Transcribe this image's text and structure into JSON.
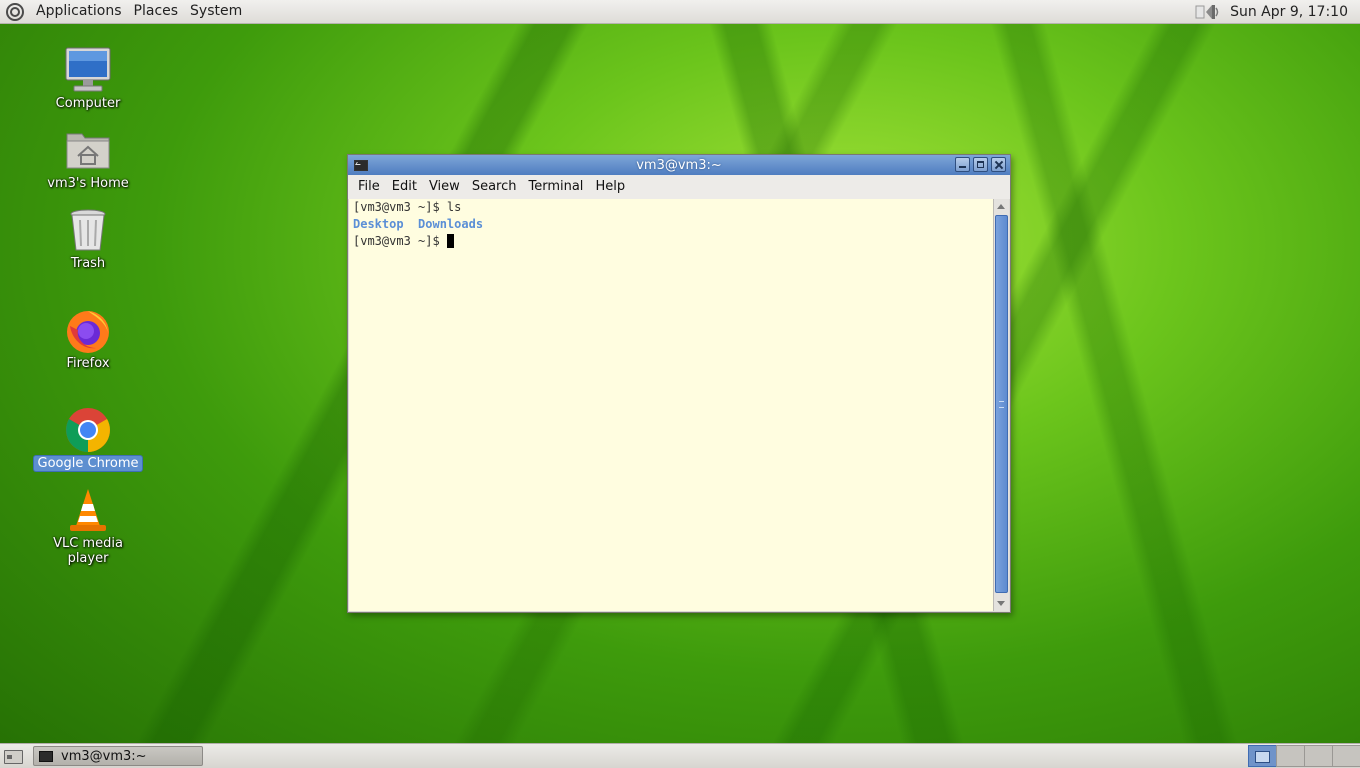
{
  "top_panel": {
    "menus": [
      "Applications",
      "Places",
      "System"
    ],
    "clock": "Sun Apr  9, 17:10"
  },
  "desktop_icons": [
    {
      "label": "Computer",
      "icon": "computer-icon"
    },
    {
      "label": "vm3's Home",
      "icon": "home-folder-icon"
    },
    {
      "label": "Trash",
      "icon": "trash-icon"
    },
    {
      "label": "Firefox",
      "icon": "firefox-icon"
    },
    {
      "label": "Google Chrome",
      "icon": "chrome-icon",
      "selected": true
    },
    {
      "label": "VLC media player",
      "icon": "vlc-icon"
    }
  ],
  "terminal": {
    "title": "vm3@vm3:~",
    "menus": [
      "File",
      "Edit",
      "View",
      "Search",
      "Terminal",
      "Help"
    ],
    "lines": {
      "line1": "[vm3@vm3 ~]$ ls",
      "dir1": "Desktop",
      "dir2": "Downloads",
      "prompt": "[vm3@vm3 ~]$ "
    },
    "background_color": "#fffde0",
    "directory_color": "#5b8fd6"
  },
  "bottom_panel": {
    "task_label": "vm3@vm3:~",
    "workspaces": 4,
    "active_workspace": 1
  }
}
